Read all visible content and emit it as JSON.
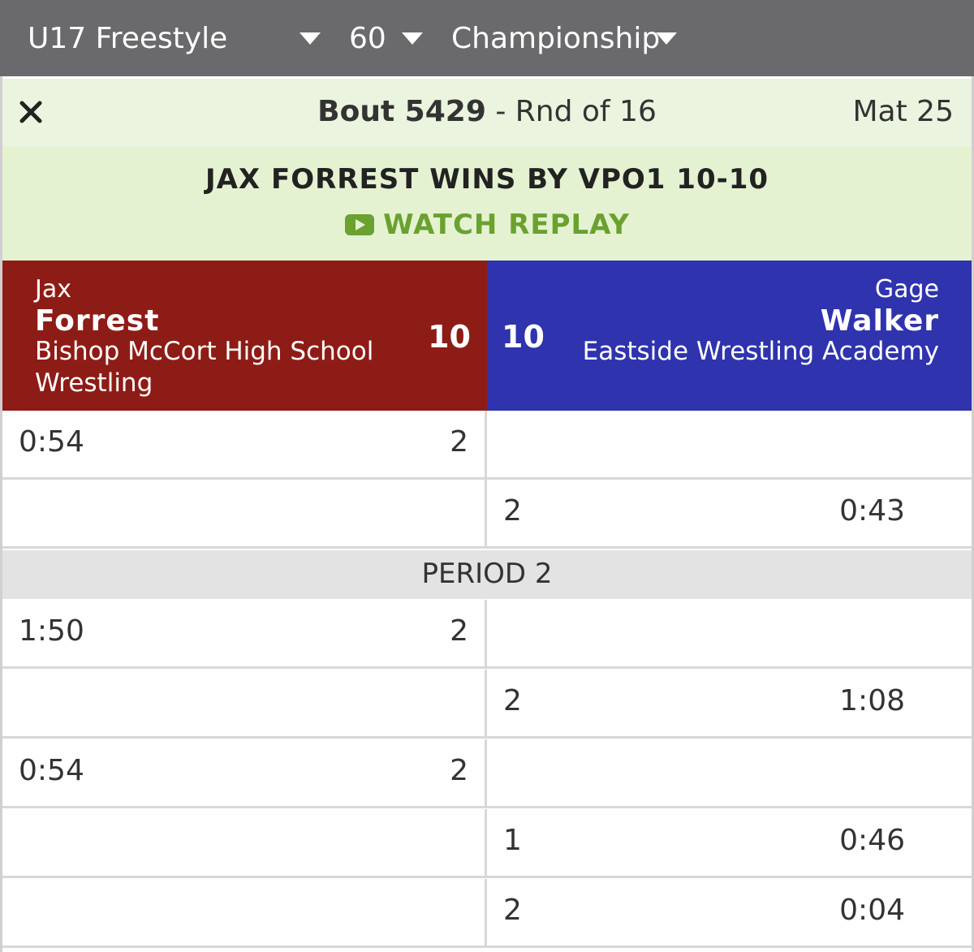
{
  "filters": {
    "division": "U17 Freestyle",
    "weight": "60",
    "bracket": "Championship"
  },
  "bout": {
    "label": "Bout 5429",
    "round": " - Rnd of 16",
    "mat": "Mat 25"
  },
  "result": {
    "text": "JAX FORREST WINS BY VPO1 10-10",
    "replay_label": "WATCH REPLAY"
  },
  "colors": {
    "red_corner": "#8e1c16",
    "blue_corner": "#2f33ad",
    "replay_green": "#6aa12f",
    "header_bar": "#6a6a6d"
  },
  "wrestlers": {
    "red": {
      "first": "Jax",
      "last": "Forrest",
      "team": "Bishop McCort High School Wrestling",
      "score": "10"
    },
    "blue": {
      "first": "Gage",
      "last": "Walker",
      "team": "Eastside Wrestling Academy",
      "score": "10"
    }
  },
  "period_label": "PERIOD 2",
  "scoring": {
    "period1": [
      {
        "red_time": "0:54",
        "red_pts": "2",
        "blue_pts": "",
        "blue_time": ""
      },
      {
        "red_time": "",
        "red_pts": "",
        "blue_pts": "2",
        "blue_time": "0:43"
      }
    ],
    "period2": [
      {
        "red_time": "1:50",
        "red_pts": "2",
        "blue_pts": "",
        "blue_time": ""
      },
      {
        "red_time": "",
        "red_pts": "",
        "blue_pts": "2",
        "blue_time": "1:08"
      },
      {
        "red_time": "0:54",
        "red_pts": "2",
        "blue_pts": "",
        "blue_time": ""
      },
      {
        "red_time": "",
        "red_pts": "",
        "blue_pts": "1",
        "blue_time": "0:46"
      },
      {
        "red_time": "",
        "red_pts": "",
        "blue_pts": "2",
        "blue_time": "0:04"
      }
    ]
  }
}
